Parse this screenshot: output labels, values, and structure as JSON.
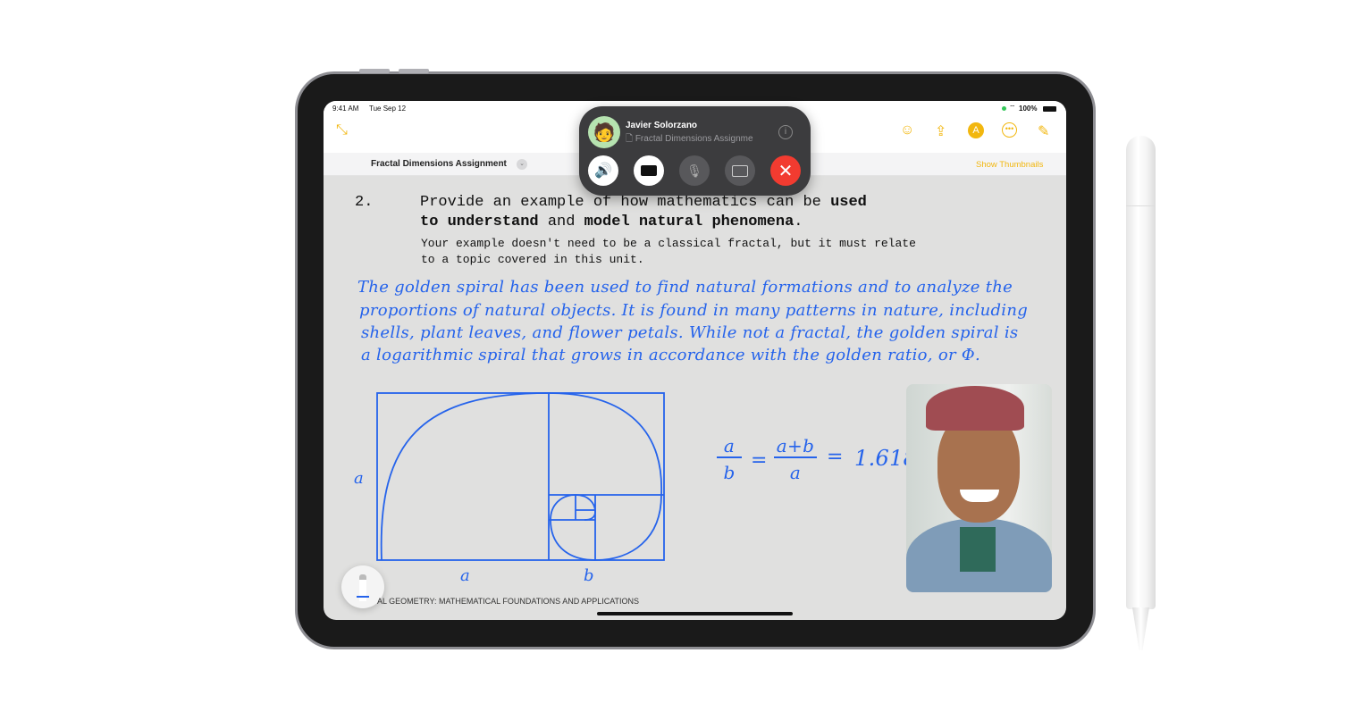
{
  "status_bar": {
    "time": "9:41 AM",
    "date": "Tue Sep 12",
    "battery": "100%"
  },
  "toolbar": {
    "icons": [
      "collapse-icon",
      "collaborate-icon",
      "share-icon",
      "markup-icon",
      "more-icon",
      "compose-icon"
    ],
    "accent": "#f2b70f"
  },
  "document": {
    "title": "Fractal Dimensions Assignment",
    "show_thumbnails": "Show Thumbnails",
    "footer": "AL GEOMETRY: MATHEMATICAL FOUNDATIONS AND APPLICATIONS"
  },
  "question": {
    "number": "2.",
    "line1_a": "Provide an example of how mathematics can be ",
    "line1_b": "used",
    "line2_a": "to understand",
    "line2_b": " and ",
    "line2_c": "model natural phenomena",
    "line2_d": ".",
    "note1": "Your example doesn't need to be a classical fractal, but it must relate",
    "note2": "to a topic covered in this unit."
  },
  "handwriting": {
    "lines": [
      "The golden spiral has been used to find natural formations and to analyze the",
      "proportions of natural objects. It is found in many patterns in nature, including",
      "shells, plant leaves, and flower petals. While not a fractal, the golden spiral is",
      "a logarithmic spiral that grows in accordance with the golden ratio, or Φ."
    ],
    "label_a_side": "a",
    "label_a_bottom": "a",
    "label_b_bottom": "b",
    "eq_num1": "a",
    "eq_den1": "b",
    "eq_equals": "=",
    "eq_num2": "a+b",
    "eq_den2": "a",
    "eq_equals2": "=",
    "eq_value": "1.618",
    "ink": "#2563eb"
  },
  "facetime": {
    "caller": "Javier Solorzano",
    "shared": "Fractal Dimensions Assignme",
    "buttons": [
      "speaker",
      "camera",
      "mute",
      "share-screen",
      "end-call"
    ],
    "end_color": "#f23b30"
  }
}
